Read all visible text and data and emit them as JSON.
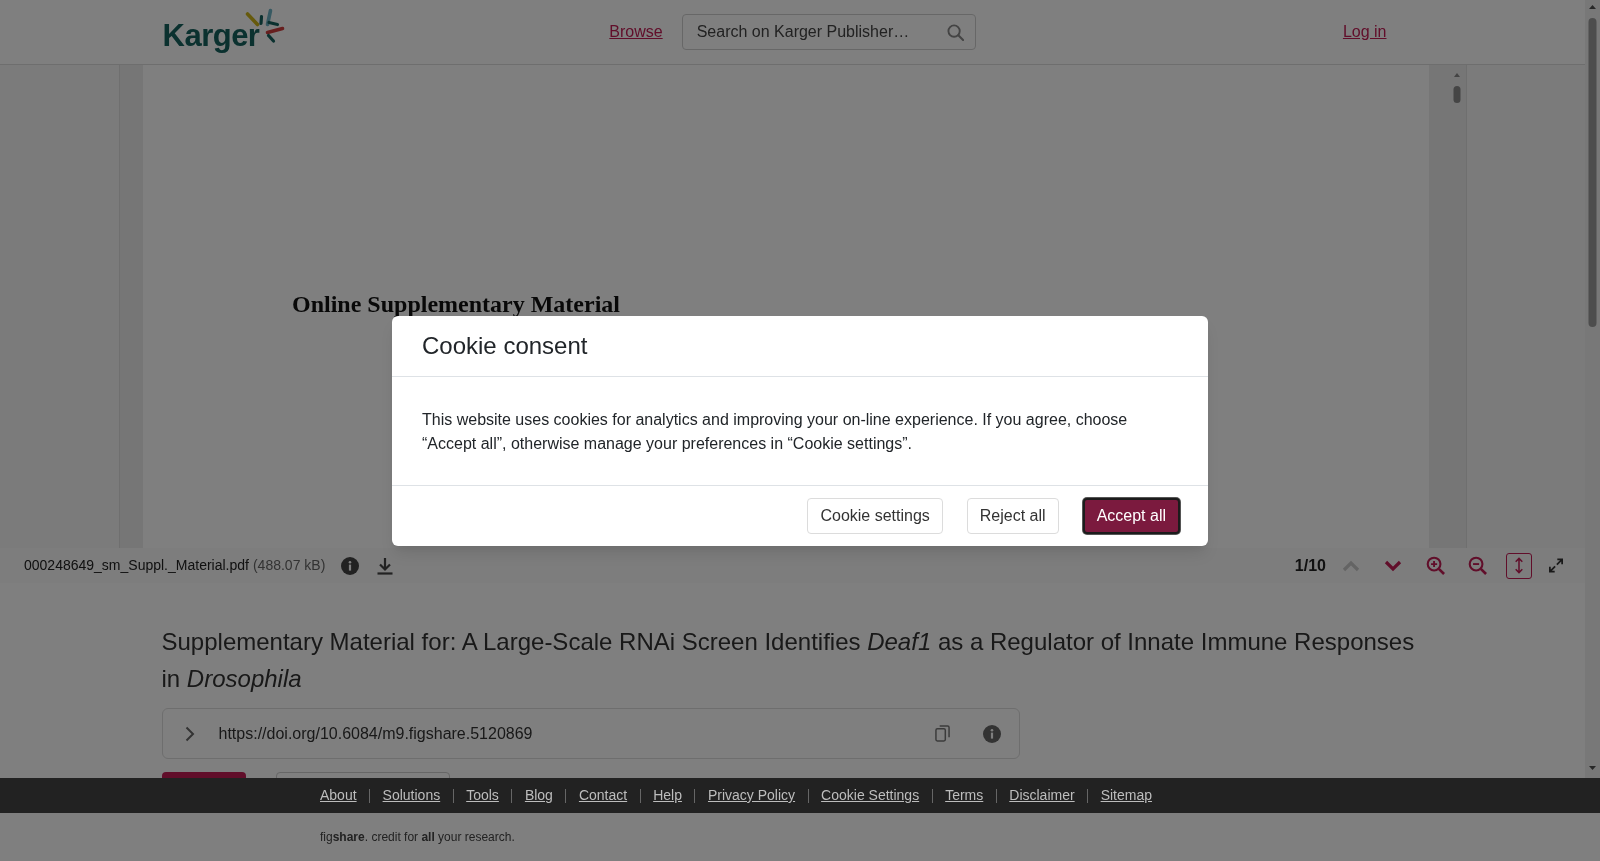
{
  "header": {
    "logo": "Karger",
    "browse": "Browse",
    "search": {
      "placeholder": "Search on Karger Publisher…"
    },
    "login": "Log in"
  },
  "viewer": {
    "page_heading": "Online Supplementary Material",
    "file_name": "000248649_sm_Suppl._Material.pdf",
    "file_size": "(488.07 kB)",
    "page_counter": "1/10",
    "tools": [
      {
        "kind": "prev",
        "disabled": true,
        "on": false
      },
      {
        "kind": "next",
        "disabled": false,
        "on": false
      },
      {
        "kind": "zoom_in",
        "disabled": false,
        "on": false
      },
      {
        "kind": "zoom_out",
        "disabled": false,
        "on": false
      },
      {
        "kind": "fit_height",
        "disabled": false,
        "on": true
      },
      {
        "kind": "fullscreen",
        "disabled": false,
        "on": false
      }
    ]
  },
  "article": {
    "title": "Supplementary Material for: A Large-Scale RNAi Screen Identifies *Deaf1* as a Regulator of Innate Immune Responses in *Drosophila*",
    "doi": "https://doi.org/10.6084/m9.figshare.5120869",
    "actions": [
      {
        "kind": "primary"
      },
      {
        "kind": "outline"
      }
    ]
  },
  "footer": {
    "links": [
      "About",
      "Solutions",
      "Tools",
      "Blog",
      "Contact",
      "Help",
      "Privacy Policy",
      "Cookie Settings",
      "Terms",
      "Disclaimer",
      "Sitemap"
    ],
    "tagline": "fig**share**. credit for **all** your research."
  },
  "cookie_dialog": {
    "title": "Cookie consent",
    "text": "This website uses cookies for analytics and improving your on-line experience. If you agree, choose “Accept all”, otherwise manage your preferences in “Cookie settings”.",
    "buttons": [
      {
        "label": "Cookie settings",
        "kind": "secondary",
        "focused": false
      },
      {
        "label": "Reject all",
        "kind": "secondary",
        "focused": false
      },
      {
        "label": "Accept all",
        "kind": "primary",
        "focused": true
      }
    ]
  }
}
